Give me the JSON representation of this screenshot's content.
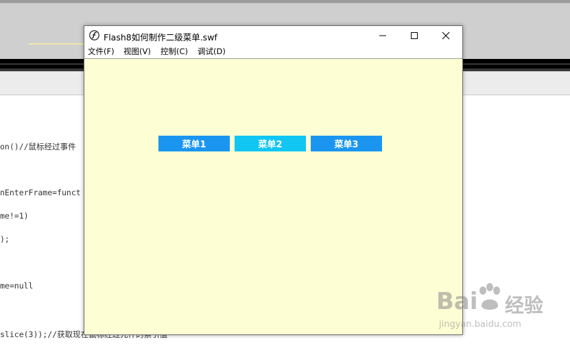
{
  "window": {
    "title": "Flash8如何制作二级菜单.swf",
    "menus": [
      {
        "label": "文件(F)"
      },
      {
        "label": "视图(V)"
      },
      {
        "label": "控制(C)"
      },
      {
        "label": "调试(D)"
      }
    ]
  },
  "stage": {
    "background": "#fefed4",
    "buttons": [
      {
        "label": "菜单1",
        "color": "#1a96f0"
      },
      {
        "label": "菜单2",
        "color": "#12c6f4"
      },
      {
        "label": "菜单3",
        "color": "#1a96f0"
      }
    ]
  },
  "background_code": {
    "lines": [
      "on()//鼠标经过事件",
      "nEnterFrame=funct",
      "me!=1)",
      ");",
      "me=null",
      "slice(3));//获取现在鼠标经过元件的索引值"
    ]
  },
  "watermark": {
    "brand": "Bai",
    "brand2": "经验",
    "url": "jingyan.baidu.com"
  }
}
